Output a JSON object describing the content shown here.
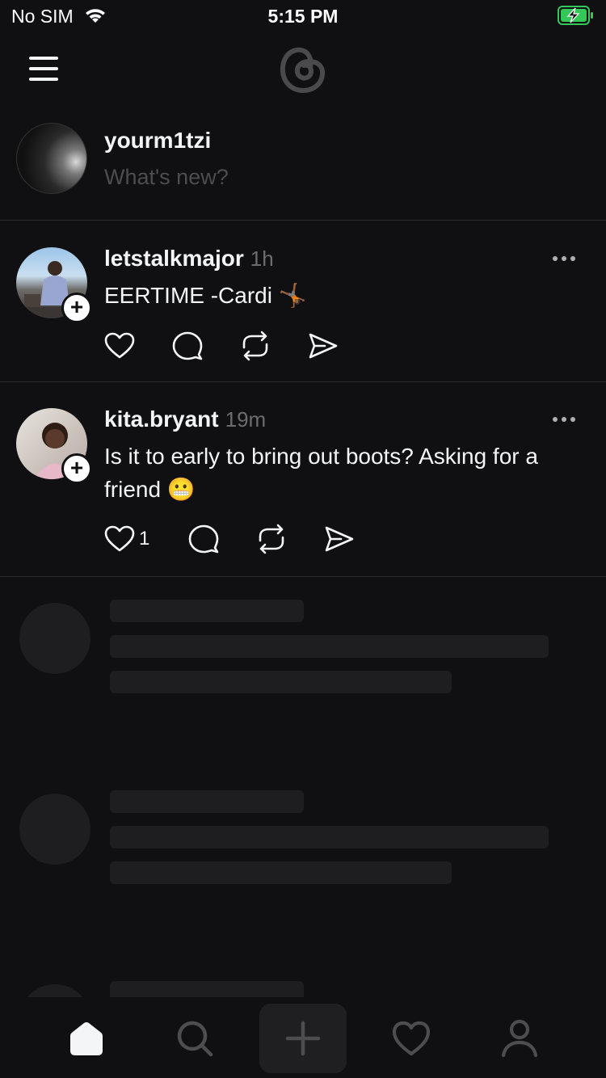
{
  "status_bar": {
    "carrier": "No SIM",
    "time": "5:15 PM"
  },
  "header": {
    "menu_icon": "hamburger-icon",
    "logo": "threads-logo"
  },
  "composer": {
    "username": "yourm1tzi",
    "placeholder": "What's new?"
  },
  "posts": [
    {
      "username": "letstalkmajor",
      "time": "1h",
      "text": "EERTIME -Cardi 🤸🏾",
      "like_count": ""
    },
    {
      "username": "kita.bryant",
      "time": "19m",
      "text": "Is it to early to bring out boots? Asking for a friend 😬",
      "like_count": "1"
    }
  ],
  "tab_bar": {
    "items": [
      "home-icon",
      "search-icon",
      "compose-icon",
      "heart-icon",
      "profile-icon"
    ],
    "active": "home"
  },
  "colors": {
    "background": "#101012",
    "text": "#f3f5f7",
    "muted": "#6c6c70",
    "skeleton": "#1e1e20",
    "battery": "#34c759"
  }
}
